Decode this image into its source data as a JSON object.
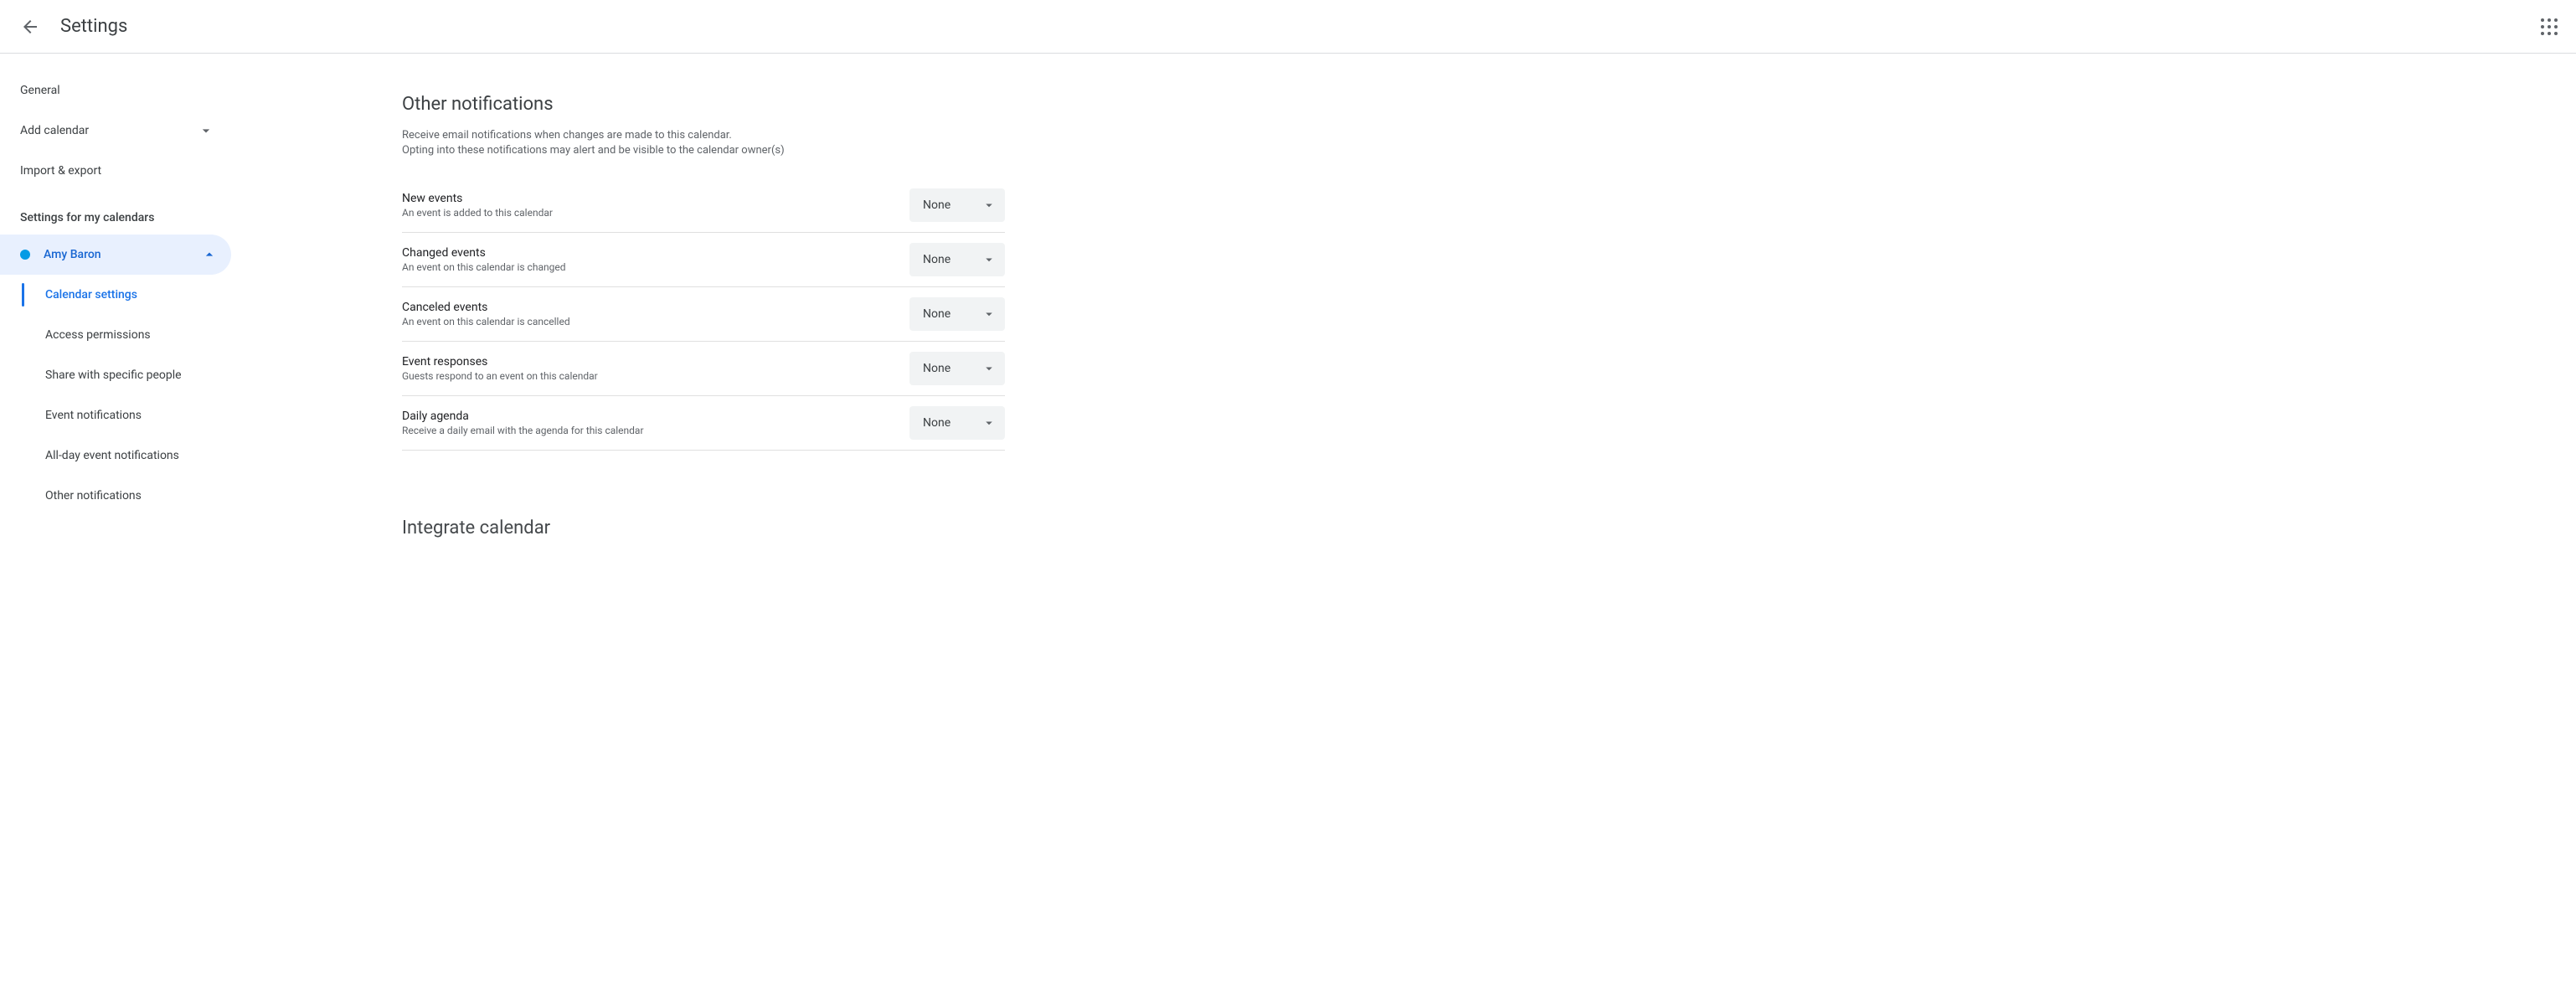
{
  "header": {
    "title": "Settings"
  },
  "sidebar": {
    "items": [
      {
        "label": "General"
      },
      {
        "label": "Add calendar"
      },
      {
        "label": "Import & export"
      }
    ],
    "section_heading": "Settings for my calendars",
    "calendar": {
      "name": "Amy Baron",
      "color": "#039be5"
    },
    "sub_items": [
      "Calendar settings",
      "Access permissions",
      "Share with specific people",
      "Event notifications",
      "All-day event notifications",
      "Other notifications"
    ]
  },
  "main": {
    "title": "Other notifications",
    "desc_line1": "Receive email notifications when changes are made to this calendar.",
    "desc_line2": "Opting into these notifications may alert and be visible to the calendar owner(s)",
    "rows": [
      {
        "label": "New events",
        "sub": "An event is added to this calendar",
        "value": "None"
      },
      {
        "label": "Changed events",
        "sub": "An event on this calendar is changed",
        "value": "None"
      },
      {
        "label": "Canceled events",
        "sub": "An event on this calendar is cancelled",
        "value": "None"
      },
      {
        "label": "Event responses",
        "sub": "Guests respond to an event on this calendar",
        "value": "None"
      },
      {
        "label": "Daily agenda",
        "sub": "Receive a daily email with the agenda for this calendar",
        "value": "None"
      }
    ],
    "next_section_title": "Integrate calendar"
  }
}
